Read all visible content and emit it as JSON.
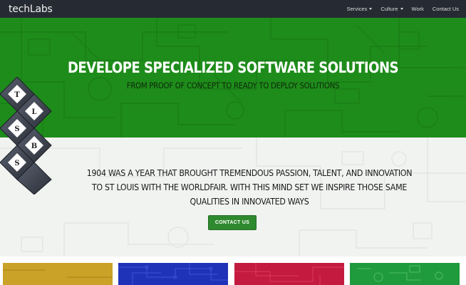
{
  "navbar": {
    "brand": "techLabs",
    "items": [
      {
        "label": "Services",
        "dropdown": true
      },
      {
        "label": "Culture",
        "dropdown": true
      },
      {
        "label": "Work",
        "dropdown": false
      },
      {
        "label": "Contact Us",
        "dropdown": false
      }
    ]
  },
  "hero": {
    "title": "DEVELOPE SPECIALIZED SOFTWARE SOLUTIONS",
    "subtitle": "FROM PROOF OF CONCEPT TO READY TO DEPLOY SOLUTIONS",
    "background_color": "#1e8c1a"
  },
  "intro": {
    "lines": [
      "1904 WAS A YEAR THAT BROUGHT TREMENDOUS PASSION, TALENT, AND INNOVATION",
      "TO ST LOUIS WITH THE WORLDFAIR. WITH THIS MIND SET WE INSPIRE THOSE SAME",
      "QUALITIES IN INNOVATED WAYS"
    ],
    "button_label": "CONTACT US",
    "button_color": "#2f8a2f"
  },
  "logo": {
    "letters": [
      "T",
      "L",
      "S",
      "B",
      "S"
    ]
  },
  "cards": [
    {
      "name": "gold-card",
      "color": "#c9a227"
    },
    {
      "name": "blue-card",
      "color": "#1f33b8"
    },
    {
      "name": "crimson-card",
      "color": "#c41a3f"
    },
    {
      "name": "green-card",
      "color": "#1f9a3c"
    }
  ]
}
